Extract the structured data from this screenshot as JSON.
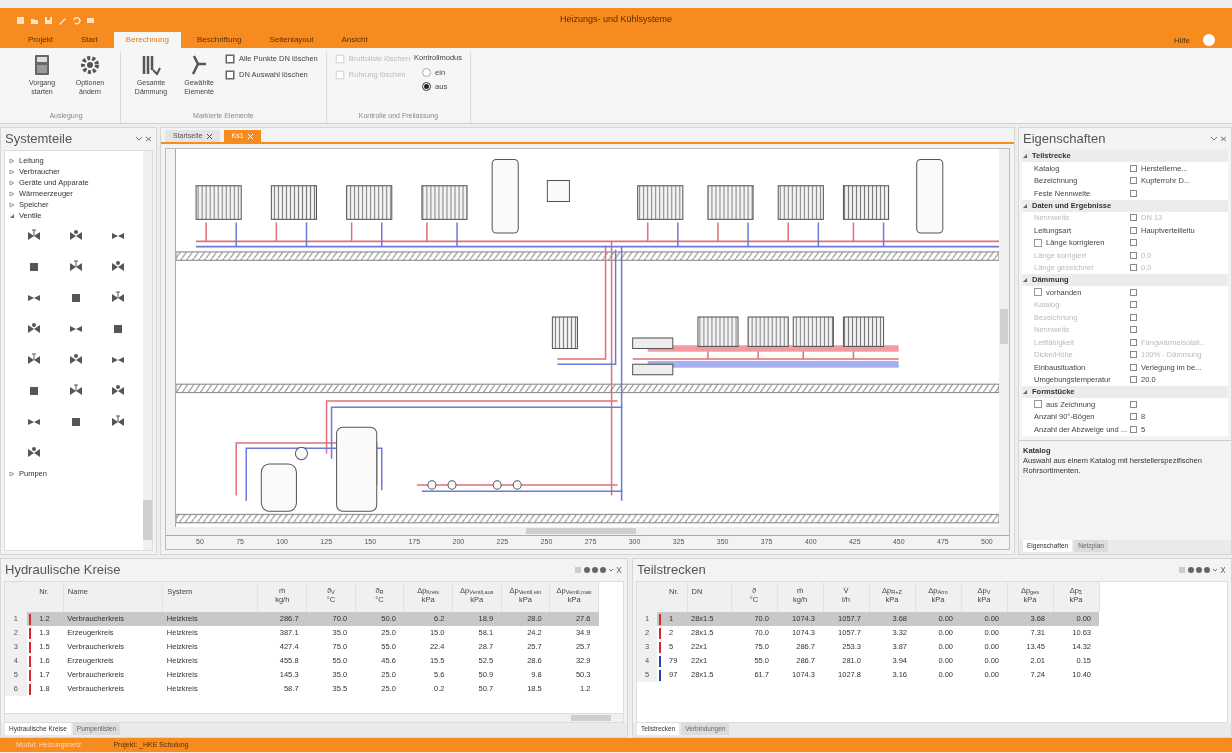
{
  "window": {
    "title": "Heizungs- und Kühlsysteme"
  },
  "menu_tabs": [
    {
      "label": "Projekt",
      "selected": false
    },
    {
      "label": "Start",
      "selected": false
    },
    {
      "label": "Berechnung",
      "selected": true
    },
    {
      "label": "Beschriftung",
      "selected": false
    },
    {
      "label": "Seitenlayout",
      "selected": false
    },
    {
      "label": "Ansicht",
      "selected": false
    }
  ],
  "help": "Hilfe",
  "ribbon": {
    "groups": [
      {
        "label": "Auslegung",
        "columns": [
          [
            {
              "kind": "large",
              "label": "Vorgang starten"
            }
          ],
          [
            {
              "kind": "large",
              "label": "Optionen ändern"
            }
          ]
        ]
      },
      {
        "label": "Markierte Elemente",
        "columns": [
          [
            {
              "kind": "large",
              "label": "Gesamte Dämmung"
            }
          ],
          [
            {
              "kind": "large",
              "label": "Gewählte Elemente"
            }
          ],
          [
            {
              "kind": "small",
              "label": "Alle Punkte DN löschen",
              "disabled": false
            },
            {
              "kind": "small",
              "label": "DN Auswahl löschen",
              "disabled": false
            }
          ]
        ]
      },
      {
        "label": "Kontrolle und Freilassung",
        "columns": [
          [
            {
              "kind": "small",
              "label": "Bruttoliste löschen",
              "disabled": true
            },
            {
              "kind": "small",
              "label": "Rohrung löschen",
              "disabled": true
            }
          ],
          [
            {
              "kind": "heading",
              "label": "Kontrollmodus"
            },
            {
              "kind": "radio",
              "label": "ein",
              "selected": false
            },
            {
              "kind": "radio",
              "label": "aus",
              "selected": true
            }
          ]
        ]
      }
    ]
  },
  "systemteile": {
    "title": "Systemteile",
    "items": [
      {
        "label": "Leitung",
        "expanded": false
      },
      {
        "label": "Verbraucher",
        "expanded": false
      },
      {
        "label": "Geräte und Apparate",
        "expanded": false
      },
      {
        "label": "Wärmeerzeuger",
        "expanded": false
      },
      {
        "label": "Speicher",
        "expanded": false
      },
      {
        "label": "Ventile",
        "expanded": true
      },
      {
        "label": "Pumpen",
        "expanded": false
      }
    ]
  },
  "document_tabs": [
    {
      "label": "Startseite",
      "selected": false
    },
    {
      "label": "Ks1",
      "selected": true
    }
  ],
  "canvas": {
    "ruler_labels": [
      "50",
      "75",
      "100",
      "125",
      "150",
      "175",
      "200",
      "225",
      "250",
      "275",
      "300",
      "325",
      "350",
      "375",
      "400",
      "425",
      "450",
      "475",
      "500"
    ]
  },
  "eigenschaften": {
    "title": "Eigenschaften",
    "groups": [
      {
        "title": "Teilstrecke",
        "expanded": true,
        "rows": [
          {
            "kind": "field",
            "label": "Katalog",
            "value": "Herstellerne...",
            "disabled": false
          },
          {
            "kind": "field",
            "label": "Bezeichnung",
            "value": "Kupferrohr D...",
            "disabled": false
          },
          {
            "kind": "field",
            "label": "Feste Nennweite",
            "disabled": false
          }
        ]
      },
      {
        "title": "Daten und Ergebnisse",
        "expanded": true,
        "rows": [
          {
            "kind": "field",
            "label": "Nennweite",
            "value": "DN 13",
            "disabled": true
          },
          {
            "kind": "field",
            "label": "Leitungsart",
            "value": "Hauptverteilleitu",
            "disabled": false
          },
          {
            "kind": "checkbox",
            "label": "Länge korrigieren",
            "checked": false
          },
          {
            "kind": "field",
            "label": "Länge korrigiert",
            "value": "0,0",
            "disabled": true
          },
          {
            "kind": "field",
            "label": "Länge gezeichnet",
            "value": "0,0",
            "disabled": true
          }
        ]
      },
      {
        "title": "Dämmung",
        "expanded": true,
        "rows": [
          {
            "kind": "checkbox",
            "label": "vorhanden",
            "checked": false
          },
          {
            "kind": "field",
            "label": "Katalog",
            "disabled": true
          },
          {
            "kind": "field",
            "label": "Bezeichnung",
            "disabled": true
          },
          {
            "kind": "field",
            "label": "Nennweite",
            "disabled": true
          },
          {
            "kind": "field",
            "label": "Leitfähigkeit",
            "value": "Fangwärmeisolati...",
            "disabled": true
          },
          {
            "kind": "field",
            "label": "Dicke/Höhe",
            "value": "100% - Dämmung",
            "disabled": true
          },
          {
            "kind": "field",
            "label": "Einbausituation",
            "value": "Verlegung im be...",
            "disabled": false
          },
          {
            "kind": "field",
            "label": "Umgebungstemperatur",
            "value": "20.0",
            "disabled": false
          }
        ]
      },
      {
        "title": "Formstücke",
        "expanded": true,
        "rows": [
          {
            "kind": "checkbox",
            "label": "aus Zeichnung",
            "checked": false
          },
          {
            "kind": "field",
            "label": "Anzahl 90°-Bögen",
            "value": "8",
            "disabled": false
          },
          {
            "kind": "field",
            "label": "Anzahl der Abzweige und ...",
            "value": "5",
            "disabled": false
          }
        ]
      }
    ],
    "description_title": "Katalog",
    "description": "Auswahl aus einem Katalog mit herstellerspezifischen Rohrsortimenten.",
    "tabs": [
      {
        "label": "Eigenschaften",
        "selected": true
      },
      {
        "label": "Netzplan",
        "selected": false
      }
    ]
  },
  "hydraulische_kreise": {
    "title": "Hydraulische Kreise",
    "columns": [
      {
        "label": "Nr."
      },
      {
        "label": "Name"
      },
      {
        "label": "System"
      },
      {
        "label": "ṁ",
        "unit": "kg/h"
      },
      {
        "label": "ϑ$_{V}$",
        "unit": "°C"
      },
      {
        "label": "ϑ$_{R}$",
        "unit": "°C"
      },
      {
        "label": "Δp$_{Kreis}$",
        "unit": "kPa"
      },
      {
        "label": "Δp$_{Ventil,aus}$",
        "unit": "kPa"
      },
      {
        "label": "Δp$_{Ventil,ein}$",
        "unit": "kPa"
      },
      {
        "label": "Δp$_{Ventil,max}$",
        "unit": "kPa"
      }
    ],
    "rows": [
      {
        "index": "1",
        "color": "#d9262b",
        "selected": true,
        "cells": [
          "1.2",
          "Verbraucherkreis",
          "Heizkreis",
          "286.7",
          "70.0",
          "50.0",
          "6.2",
          "18.9",
          "28.0",
          "27.6"
        ]
      },
      {
        "index": "2",
        "color": "#d9262b",
        "selected": false,
        "cells": [
          "1.3",
          "Erzeugerkreis",
          "Heizkreis",
          "387.1",
          "35.0",
          "25.0",
          "15.0",
          "58.1",
          "24.2",
          "34.9"
        ]
      },
      {
        "index": "3",
        "color": "#d9262b",
        "selected": false,
        "cells": [
          "1.5",
          "Verbraucherkreis",
          "Heizkreis",
          "427.4",
          "75.0",
          "55.0",
          "22.4",
          "28.7",
          "25.7",
          "25.7"
        ]
      },
      {
        "index": "4",
        "color": "#d9262b",
        "selected": false,
        "cells": [
          "1.6",
          "Erzeugerkreis",
          "Heizkreis",
          "455.8",
          "55.0",
          "45.6",
          "15.5",
          "52.5",
          "28.6",
          "32.9"
        ]
      },
      {
        "index": "5",
        "color": "#d9262b",
        "selected": false,
        "cells": [
          "1.7",
          "Verbraucherkreis",
          "Heizkreis",
          "145.3",
          "35.0",
          "25.0",
          "5.6",
          "50.9",
          "9.8",
          "50.3"
        ]
      },
      {
        "index": "6",
        "color": "#d9262b",
        "selected": false,
        "cells": [
          "1.8",
          "Verbraucherkreis",
          "Heizkreis",
          "58.7",
          "35.5",
          "25.0",
          "0.2",
          "50.7",
          "18.5",
          "1.2"
        ]
      }
    ],
    "tabs": [
      {
        "label": "Hydraulische Kreise",
        "selected": true
      },
      {
        "label": "Pumpenlisten",
        "selected": false
      }
    ]
  },
  "teilstrecken": {
    "title": "Teilstrecken",
    "columns": [
      {
        "label": "Nr."
      },
      {
        "label": "DN"
      },
      {
        "label": "ϑ",
        "unit": "°C"
      },
      {
        "label": "ṁ",
        "unit": "kg/h"
      },
      {
        "label": "V̇",
        "unit": "l/h"
      },
      {
        "label": "Δp$_{R+Z}$",
        "unit": "kPa"
      },
      {
        "label": "Δp$_{Arm}$",
        "unit": "kPa"
      },
      {
        "label": "Δp$_{V}$",
        "unit": "kPa"
      },
      {
        "label": "Δp$_{ges}$",
        "unit": "kPa"
      },
      {
        "label": "Δp$_{Σ}$",
        "unit": "kPa"
      }
    ],
    "rows": [
      {
        "index": "1",
        "color": "#d9262b",
        "selected": true,
        "cells": [
          "1",
          "28x1.5",
          "70.0",
          "1074.3",
          "1057.7",
          "3.68",
          "0.00",
          "0.00",
          "3.68",
          "0.00"
        ]
      },
      {
        "index": "2",
        "color": "#d9262b",
        "selected": false,
        "cells": [
          "2",
          "28x1.5",
          "70.0",
          "1074.3",
          "1057.7",
          "3.32",
          "0.00",
          "0.00",
          "7.31",
          "10.63"
        ]
      },
      {
        "index": "3",
        "color": "#d9262b",
        "selected": false,
        "cells": [
          "5",
          "22x1",
          "75.0",
          "286.7",
          "253.3",
          "3.87",
          "0.00",
          "0.00",
          "13.45",
          "14.32"
        ]
      },
      {
        "index": "4",
        "color": "#2b3fb5",
        "selected": false,
        "cells": [
          "79",
          "22x1",
          "55.0",
          "286.7",
          "281.0",
          "3.94",
          "0.00",
          "0.00",
          "2.01",
          "0.15"
        ]
      },
      {
        "index": "5",
        "color": "#2b3fb5",
        "selected": false,
        "cells": [
          "97",
          "28x1.5",
          "61.7",
          "1074.3",
          "1027.8",
          "3.16",
          "0.00",
          "0.00",
          "7.24",
          "10.40"
        ]
      }
    ],
    "tabs": [
      {
        "label": "Teilstrecken",
        "selected": true
      },
      {
        "label": "Verbindungen",
        "selected": false
      }
    ]
  },
  "status_bar": {
    "left": "Modul: Heizungsnetz",
    "project": "Projekt: _HKE Schulung"
  }
}
